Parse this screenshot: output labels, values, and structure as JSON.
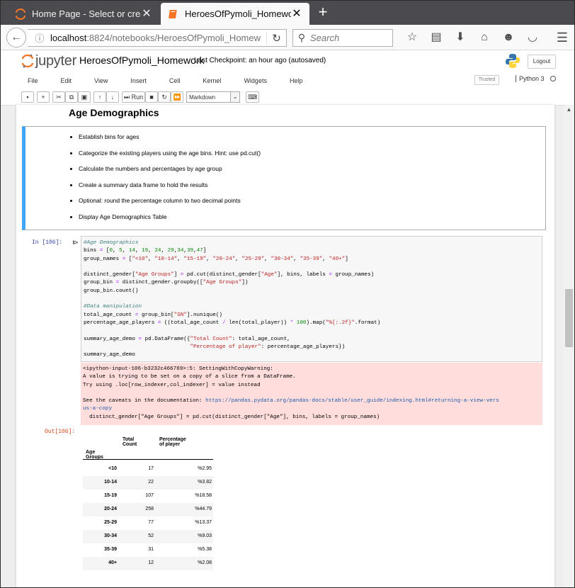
{
  "browser": {
    "tabs": [
      {
        "title": "Home Page - Select or create a notebook",
        "close": "✕"
      },
      {
        "title": "HeroesOfPymoli_Homework",
        "close": "✕"
      }
    ],
    "new_tab": "+",
    "url_host": "localhost",
    "url_rest": ":8824/notebooks/HeroesOfPymoli_Homew",
    "search_placeholder": "Search"
  },
  "jupyter": {
    "logo_text": "jupyter",
    "notebook_name": "HeroesOfPymoli_Homework",
    "checkpoint": "Last Checkpoint: an hour ago  (autosaved)",
    "logout_label": "Logout",
    "menu": [
      "File",
      "Edit",
      "View",
      "Insert",
      "Cell",
      "Kernel",
      "Widgets",
      "Help"
    ],
    "trusted_label": "Trusted",
    "kernel_name": "Python 3",
    "toolbar": {
      "run_label": "Run",
      "cell_type": "Markdown"
    }
  },
  "notebook": {
    "heading": "Age Demographics",
    "markdown_items": [
      "Establish bins for ages",
      "Categorize the existing players using the age bins. Hint: use pd.cut()",
      "Calculate the numbers and percentages by age group",
      "Create a summary data frame to hold the results",
      "Optional: round the percentage column to two decimal points",
      "Display Age Demographics Table"
    ],
    "in_prompt": "In [106]:",
    "out_prompt": "Out[106]:",
    "code_lines": [
      "#Age Demographics",
      "bins = [0, 5, 14, 19, 24, 29,34,39,47]",
      "group_names = [\"<10\", \"10-14\", \"15-19\", \"20-24\", \"25-29\", \"30-34\", \"35-39\", \"40+\"]",
      "",
      "distinct_gender[\"Age Groups\"] = pd.cut(distinct_gender[\"Age\"], bins, labels = group_names)",
      "group_bin = distinct_gender.groupby([\"Age Groups\"])",
      "group_bin.count()",
      "",
      "#Data manipulation",
      "total_age_count = group_bin[\"SN\"].nunique()",
      "percentage_age_players = ((total_age_count / len(total_player)) * 100).map(\"%{:.2f}\".format)",
      "",
      "summary_age_demo = pd.DataFrame({\"Total Count\": total_age_count,",
      "                                 \"Percentage of player\": percentage_age_players})",
      "summary_age_demo"
    ],
    "stderr_lines": [
      "<ipython-input-106-b3232c466769>:5: SettingWithCopyWarning:",
      "A value is trying to be set on a copy of a slice from a DataFrame.",
      "Try using .loc[row_indexer,col_indexer] = value instead",
      "",
      "See the caveats in the documentation: https://pandas.pydata.org/pandas-docs/stable/user_guide/indexing.html#returning-a-view-vers",
      "us-a-copy",
      "  distinct_gender[\"Age Groups\"] = pd.cut(distinct_gender[\"Age\"], bins, labels = group_names)"
    ],
    "dataframe": {
      "columns": [
        "Total Count",
        "Percentage of player"
      ],
      "index_name": "Age Groups",
      "rows": [
        {
          "group": "<10",
          "count": "17",
          "pct": "%2.95"
        },
        {
          "group": "10-14",
          "count": "22",
          "pct": "%3.82"
        },
        {
          "group": "15-19",
          "count": "107",
          "pct": "%18.58"
        },
        {
          "group": "20-24",
          "count": "258",
          "pct": "%44.79"
        },
        {
          "group": "25-29",
          "count": "77",
          "pct": "%13.37"
        },
        {
          "group": "30-34",
          "count": "52",
          "pct": "%9.03"
        },
        {
          "group": "35-39",
          "count": "31",
          "pct": "%5.38"
        },
        {
          "group": "40+",
          "count": "12",
          "pct": "%2.08"
        }
      ]
    }
  },
  "colors": {
    "tabbar": "#4a4a4f",
    "markdown_border": "#42a5f5",
    "stderr_bg": "#ffdddd",
    "in_prompt": "#303f9f",
    "out_prompt": "#d84315"
  }
}
